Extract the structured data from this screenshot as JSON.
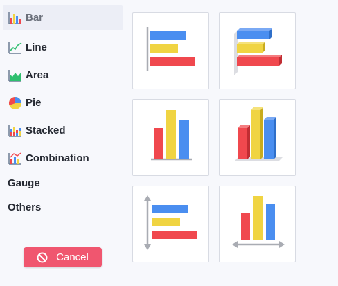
{
  "sidebar": {
    "items": [
      {
        "label": "Bar",
        "icon": "bar-chart-icon",
        "active": true
      },
      {
        "label": "Line",
        "icon": "line-chart-icon",
        "active": false
      },
      {
        "label": "Area",
        "icon": "area-chart-icon",
        "active": false
      },
      {
        "label": "Pie",
        "icon": "pie-chart-icon",
        "active": false
      },
      {
        "label": "Stacked",
        "icon": "stacked-chart-icon",
        "active": false
      },
      {
        "label": "Combination",
        "icon": "combination-chart-icon",
        "active": false
      },
      {
        "label": "Gauge",
        "icon": "",
        "active": false
      },
      {
        "label": "Others",
        "icon": "",
        "active": false
      }
    ]
  },
  "cancel_button": {
    "label": "Cancel",
    "icon": "cancel-icon",
    "color": "#f0566f"
  },
  "chart_tiles": [
    {
      "name": "horizontal-bar",
      "icon": "horizontal-bar-chart-icon"
    },
    {
      "name": "horizontal-bar-3d",
      "icon": "horizontal-bar-3d-chart-icon"
    },
    {
      "name": "vertical-column",
      "icon": "column-chart-icon"
    },
    {
      "name": "vertical-column-3d",
      "icon": "column-3d-chart-icon"
    },
    {
      "name": "horizontal-bar-axis-arrows",
      "icon": "horizontal-bar-arrow-chart-icon"
    },
    {
      "name": "vertical-column-axis-arrows",
      "icon": "column-arrow-chart-icon"
    }
  ],
  "colors": {
    "blue": "#4a8ef0",
    "yellow": "#f0d442",
    "red": "#f0484e",
    "accent": "#f0566f"
  }
}
